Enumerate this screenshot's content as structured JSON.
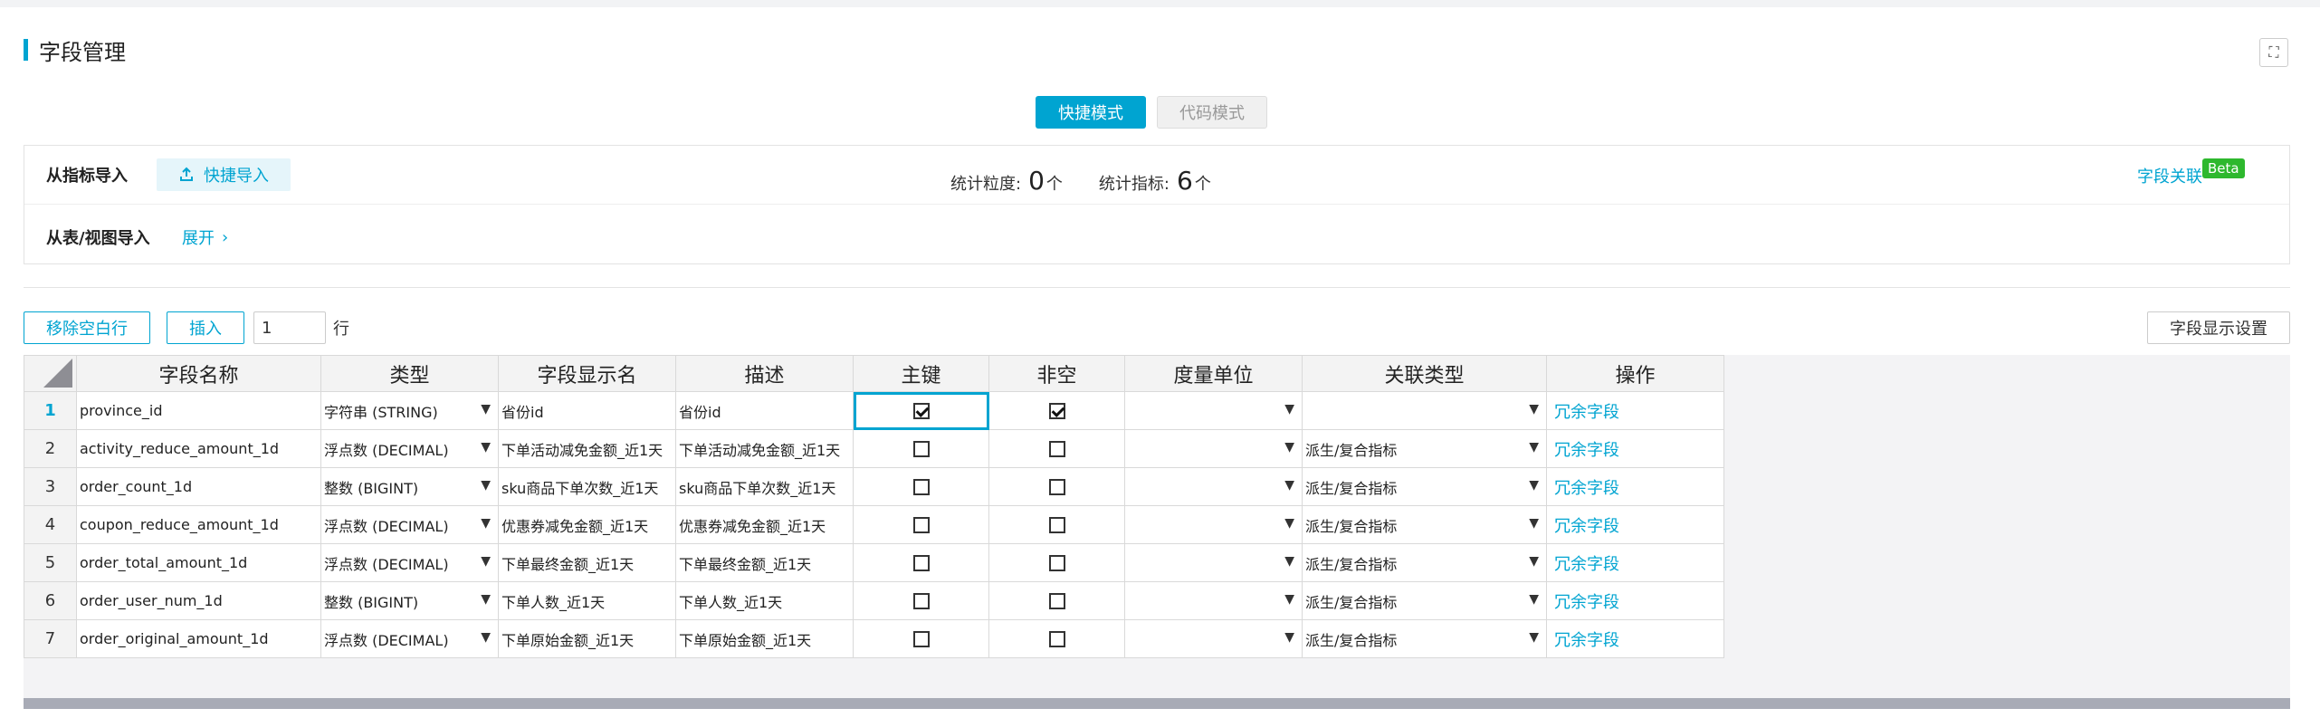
{
  "header": {
    "title": "字段管理"
  },
  "modes": {
    "active": "快捷模式",
    "inactive": "代码模式"
  },
  "import": {
    "from_metric_label": "从指标导入",
    "quick_import_label": "快捷导入",
    "stat_granularity_label": "统计粒度:",
    "stat_granularity_value": "0",
    "stat_metric_label": "统计指标:",
    "stat_metric_value": "6",
    "unit": "个",
    "field_link_label": "字段关联",
    "beta_badge": "Beta",
    "from_table_label": "从表/视图导入",
    "expand_label": "展开"
  },
  "toolbar": {
    "remove_empty_label": "移除空白行",
    "insert_label": "插入",
    "insert_count": "1",
    "row_unit": "行",
    "display_settings_label": "字段显示设置"
  },
  "grid": {
    "columns": [
      "字段名称",
      "类型",
      "字段显示名",
      "描述",
      "主键",
      "非空",
      "度量单位",
      "关联类型",
      "操作"
    ],
    "rows": [
      {
        "num": "1",
        "name": "province_id",
        "type": "字符串 (STRING)",
        "display": "省份id",
        "desc": "省份id",
        "pk": true,
        "notnull": true,
        "unit": "",
        "rel": "",
        "op": "冗余字段"
      },
      {
        "num": "2",
        "name": "activity_reduce_amount_1d",
        "type": "浮点数 (DECIMAL)",
        "display": "下单活动减免金额_近1天",
        "desc": "下单活动减免金额_近1天",
        "pk": false,
        "notnull": false,
        "unit": "",
        "rel": "派生/复合指标",
        "op": "冗余字段"
      },
      {
        "num": "3",
        "name": "order_count_1d",
        "type": "整数 (BIGINT)",
        "display": "sku商品下单次数_近1天",
        "desc": "sku商品下单次数_近1天",
        "pk": false,
        "notnull": false,
        "unit": "",
        "rel": "派生/复合指标",
        "op": "冗余字段"
      },
      {
        "num": "4",
        "name": "coupon_reduce_amount_1d",
        "type": "浮点数 (DECIMAL)",
        "display": "优惠券减免金额_近1天",
        "desc": "优惠券减免金额_近1天",
        "pk": false,
        "notnull": false,
        "unit": "",
        "rel": "派生/复合指标",
        "op": "冗余字段"
      },
      {
        "num": "5",
        "name": "order_total_amount_1d",
        "type": "浮点数 (DECIMAL)",
        "display": "下单最终金额_近1天",
        "desc": "下单最终金额_近1天",
        "pk": false,
        "notnull": false,
        "unit": "",
        "rel": "派生/复合指标",
        "op": "冗余字段"
      },
      {
        "num": "6",
        "name": "order_user_num_1d",
        "type": "整数 (BIGINT)",
        "display": "下单人数_近1天",
        "desc": "下单人数_近1天",
        "pk": false,
        "notnull": false,
        "unit": "",
        "rel": "派生/复合指标",
        "op": "冗余字段"
      },
      {
        "num": "7",
        "name": "order_original_amount_1d",
        "type": "浮点数 (DECIMAL)",
        "display": "下单原始金额_近1天",
        "desc": "下单原始金额_近1天",
        "pk": false,
        "notnull": false,
        "unit": "",
        "rel": "派生/复合指标",
        "op": "冗余字段"
      }
    ]
  },
  "colors": {
    "accent": "#00a4d1",
    "beta": "#2eb82e",
    "scrollbar": "#a8abb6"
  },
  "icons": {
    "fullscreen": "expand-icon",
    "import": "upload-icon",
    "expand": "chevron-right-icon",
    "select": "caret-down-icon"
  }
}
